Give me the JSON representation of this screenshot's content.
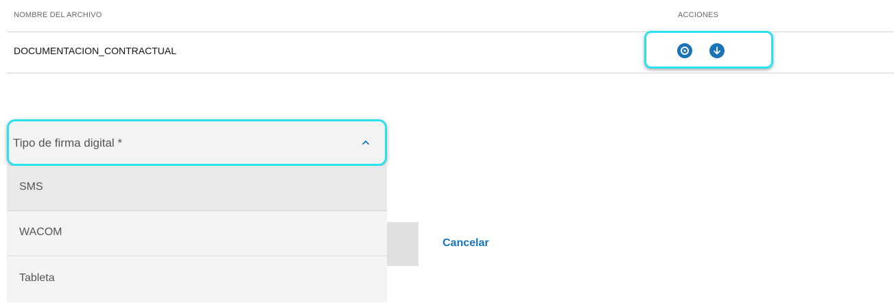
{
  "table": {
    "header_name": "NOMBRE DEL ARCHIVO",
    "header_actions": "ACCIONES",
    "rows": [
      {
        "file_name": "DOCUMENTACION_CONTRACTUAL"
      }
    ]
  },
  "actions": {
    "icons": [
      "eye-icon",
      "download-icon"
    ],
    "color": "#1973b8"
  },
  "signature_select": {
    "label": "Tipo de firma digital *",
    "expanded": true,
    "options": [
      "SMS",
      "WACOM",
      "Tableta"
    ]
  },
  "cancel_label": "Cancelar",
  "colors": {
    "highlight": "#29e2ee",
    "accent": "#1973b8"
  }
}
